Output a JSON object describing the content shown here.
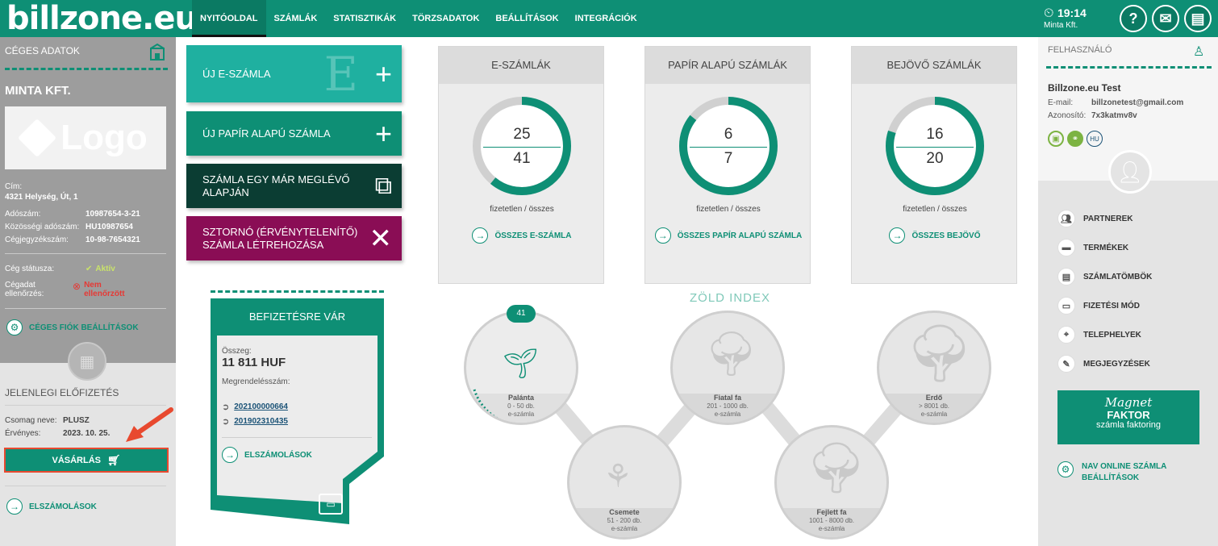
{
  "brand": {
    "logo": "billzone.eu"
  },
  "nav": [
    "NYITÓOLDAL",
    "SZÁMLÁK",
    "STATISZTIKÁK",
    "TÖRZSADATOK",
    "BEÁLLÍTÁSOK",
    "INTEGRÁCIÓK"
  ],
  "header": {
    "time": "19:14",
    "company": "Minta Kft.",
    "icons": [
      "help-icon",
      "mail-icon",
      "document-icon"
    ]
  },
  "left": {
    "title": "CÉGES ADATOK",
    "company": "MINTA KFT.",
    "logo_text": "Logo",
    "address_label": "Cím:",
    "address": "4321 Helység, Út, 1",
    "tax_label": "Adószám:",
    "tax": "10987654-3-21",
    "eu_tax_label": "Közösségi adószám:",
    "eu_tax": "HU10987654",
    "reg_label": "Cégjegyzékszám:",
    "reg": "10-98-7654321",
    "status_label": "Cég státusza:",
    "status": "Aktív",
    "check_label": "Cégadat ellenőrzés:",
    "check_l1": "Nem",
    "check_l2": "ellenőrzött",
    "settings": "CÉGES FIÓK BEÁLLÍTÁSOK",
    "sub_title": "JELENLEGI ELŐFIZETÉS",
    "pkg_label": "Csomag neve:",
    "pkg": "PLUSZ",
    "valid_label": "Érvényes:",
    "valid": "2023. 10. 25.",
    "buy": "VÁSÁRLÁS",
    "accounts": "ELSZÁMOLÁSOK"
  },
  "actions": {
    "new_e": "ÚJ E-SZÁMLA",
    "big_e": "E",
    "new_paper": "ÚJ PAPÍR ALAPÚ SZÁMLA",
    "copy_l1": "SZÁMLA EGY MÁR MEGLÉVŐ",
    "copy_l2": "ALAPJÁN",
    "storno_l1": "SZTORNÓ (ÉRVÉNYTELENÍTŐ)",
    "storno_l2": "SZÁMLA LÉTREHOZÁSA"
  },
  "cards": [
    {
      "title": "E-SZÁMLÁK",
      "unpaid": "25",
      "total": "41",
      "fraction": 0.61,
      "sub1": "fizetetlen",
      "sub2": "összes",
      "link": "ÖSSZES E-SZÁMLA"
    },
    {
      "title": "PAPÍR ALAPÚ SZÁMLÁK",
      "unpaid": "6",
      "total": "7",
      "fraction": 0.857,
      "sub1": "fizetetlen",
      "sub2": "összes",
      "link": "ÖSSZES PAPÍR ALAPÚ SZÁMLA"
    },
    {
      "title": "BEJÖVŐ SZÁMLÁK",
      "unpaid": "16",
      "total": "20",
      "fraction": 0.8,
      "sub1": "fizetetlen",
      "sub2": "összes",
      "link": "ÖSSZES BEJÖVŐ"
    }
  ],
  "payment": {
    "title": "BEFIZETÉSRE VÁR",
    "amount_label": "Összeg:",
    "amount": "11 811 HUF",
    "order_label": "Megrendelésszám:",
    "orders": [
      "202100000664",
      "201902310435"
    ],
    "link": "ELSZÁMOLÁSOK"
  },
  "green_index": {
    "title": "ZÖLD INDEX",
    "badge": "41",
    "levels": [
      {
        "name": "Palánta",
        "range": "0 - 50 db.",
        "unit": "e-számla"
      },
      {
        "name": "Csemete",
        "range": "51 - 200 db.",
        "unit": "e-számla"
      },
      {
        "name": "Fiatal fa",
        "range": "201 - 1000 db.",
        "unit": "e-számla"
      },
      {
        "name": "Fejlett fa",
        "range": "1001 - 8000 db.",
        "unit": "e-számla"
      },
      {
        "name": "Erdő",
        "range": "> 8001 db.",
        "unit": "e-számla"
      }
    ]
  },
  "right": {
    "title": "FELHASZNÁLÓ",
    "user": "Billzone.eu Test",
    "email_label": "E-mail:",
    "email": "billzonetest@gmail.com",
    "id_label": "Azonosító:",
    "id": "7x3katmv8v",
    "lang": "HU",
    "menu": [
      "PARTNEREK",
      "TERMÉKEK",
      "SZÁMLATÖMBÖK",
      "FIZETÉSI MÓD",
      "TELEPHELYEK",
      "MEGJEGYZÉSEK"
    ],
    "magnet_l1": "Magnet",
    "magnet_l2": "FAKTOR",
    "magnet_l3": "számla faktoring",
    "nav_l1": "NAV ONLINE SZÁMLA",
    "nav_l2": "BEÁLLÍTÁSOK"
  },
  "colors": {
    "primary": "#0e8f75",
    "dark": "#0b3d33",
    "magenta": "#8a0d55",
    "teal": "#1fb0a0"
  }
}
